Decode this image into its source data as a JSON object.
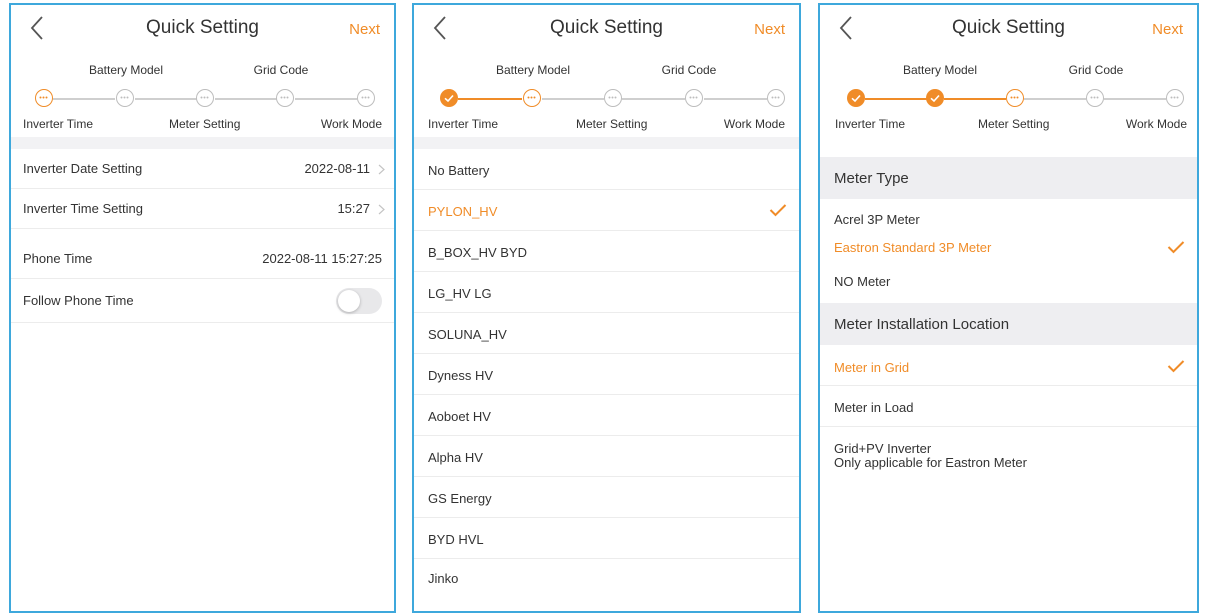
{
  "app": {
    "title": "Quick Setting",
    "next_label": "Next",
    "accent_color": "#f08c28",
    "border_color": "#3ea8dc"
  },
  "steps": {
    "top": [
      "Battery Model",
      "Grid Code"
    ],
    "bottom": [
      "Inverter Time",
      "Meter Setting",
      "Work Mode"
    ]
  },
  "screen1": {
    "rows": [
      {
        "label": "Inverter Date Setting",
        "value": "2022-08-11"
      },
      {
        "label": "Inverter Time Setting",
        "value": "15:27"
      }
    ],
    "phone_time": {
      "label": "Phone Time",
      "value": "2022-08-11 15:27:25"
    },
    "follow": {
      "label": "Follow Phone Time",
      "enabled": false
    }
  },
  "screen2": {
    "batteries": [
      {
        "label": "No Battery",
        "selected": false
      },
      {
        "label": "PYLON_HV",
        "selected": true
      },
      {
        "label": "B_BOX_HV BYD",
        "selected": false
      },
      {
        "label": "LG_HV LG",
        "selected": false
      },
      {
        "label": "SOLUNA_HV",
        "selected": false
      },
      {
        "label": "Dyness HV",
        "selected": false
      },
      {
        "label": "Aoboet HV",
        "selected": false
      },
      {
        "label": "Alpha HV",
        "selected": false
      },
      {
        "label": "GS Energy",
        "selected": false
      },
      {
        "label": "BYD HVL",
        "selected": false
      },
      {
        "label": "Jinko",
        "selected": false
      }
    ]
  },
  "screen3": {
    "meter_type_header": "Meter Type",
    "meter_types": [
      {
        "label": "Acrel 3P Meter",
        "selected": false
      },
      {
        "label": "Eastron Standard 3P Meter",
        "selected": true
      },
      {
        "label": "NO Meter",
        "selected": false
      }
    ],
    "location_header": "Meter Installation Location",
    "locations": [
      {
        "label": "Meter in Grid",
        "selected": true
      },
      {
        "label": "Meter in Load",
        "selected": false
      }
    ],
    "grid_pv": {
      "line1": "Grid+PV Inverter",
      "line2": "Only applicable for Eastron Meter"
    }
  }
}
